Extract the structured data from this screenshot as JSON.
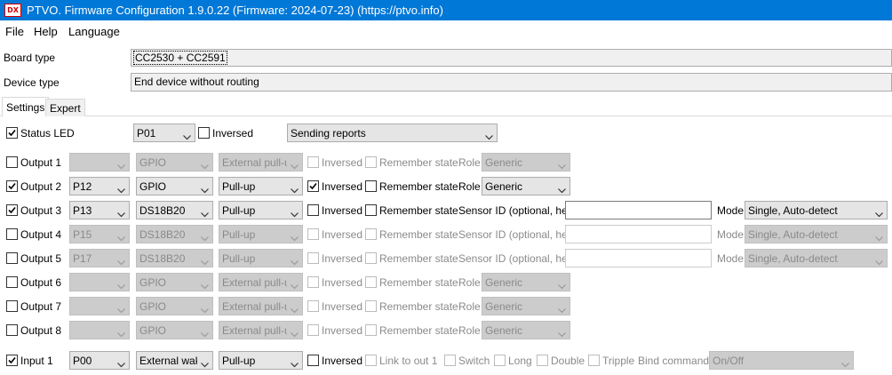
{
  "window": {
    "title": "PTVO. Firmware Configuration 1.9.0.22 (Firmware: 2024-07-23) (https://ptvo.info)",
    "icon_text": "DX"
  },
  "menu": [
    "File",
    "Help",
    "Language"
  ],
  "board": {
    "label": "Board type",
    "value": "CC2530 + CC2591"
  },
  "device": {
    "label": "Device type",
    "value": "End device without routing"
  },
  "tabs": [
    "Settings",
    "Expert"
  ],
  "common": {
    "inversed": "Inversed",
    "remember": "Remember state",
    "role": "Role",
    "sensor_id": "Sensor ID (optional, hex)",
    "mode": "Mode"
  },
  "status_led": {
    "label": "Status LED",
    "checked": true,
    "pin": "P01",
    "inversed_checked": false,
    "mode": "Sending reports"
  },
  "outputs": [
    {
      "label": "Output 1",
      "checked": false,
      "pin": "",
      "type": "GPIO",
      "pull": "External pull-up",
      "inversed": false,
      "remember": false,
      "kind": "role",
      "role": "Generic"
    },
    {
      "label": "Output 2",
      "checked": true,
      "pin": "P12",
      "type": "GPIO",
      "pull": "Pull-up",
      "inversed": true,
      "remember": false,
      "kind": "role",
      "role": "Generic"
    },
    {
      "label": "Output 3",
      "checked": true,
      "pin": "P13",
      "type": "DS18B20",
      "pull": "Pull-up",
      "inversed": false,
      "remember": false,
      "kind": "sensor",
      "sensor_id": "",
      "mode": "Single, Auto-detect"
    },
    {
      "label": "Output 4",
      "checked": false,
      "pin": "P15",
      "type": "DS18B20",
      "pull": "Pull-up",
      "inversed": false,
      "remember": false,
      "kind": "sensor",
      "sensor_id": "",
      "mode": "Single, Auto-detect"
    },
    {
      "label": "Output 5",
      "checked": false,
      "pin": "P17",
      "type": "DS18B20",
      "pull": "Pull-up",
      "inversed": false,
      "remember": false,
      "kind": "sensor",
      "sensor_id": "",
      "mode": "Single, Auto-detect"
    },
    {
      "label": "Output 6",
      "checked": false,
      "pin": "",
      "type": "GPIO",
      "pull": "External pull-up",
      "inversed": false,
      "remember": false,
      "kind": "role",
      "role": "Generic"
    },
    {
      "label": "Output 7",
      "checked": false,
      "pin": "",
      "type": "GPIO",
      "pull": "External pull-up",
      "inversed": false,
      "remember": false,
      "kind": "role",
      "role": "Generic"
    },
    {
      "label": "Output 8",
      "checked": false,
      "pin": "",
      "type": "GPIO",
      "pull": "External pull-up",
      "inversed": false,
      "remember": false,
      "kind": "role",
      "role": "Generic"
    }
  ],
  "input1": {
    "label": "Input 1",
    "checked": true,
    "pin": "P00",
    "type": "External wake",
    "pull": "Pull-up",
    "inversed": false,
    "link_label": "Link to out 1",
    "switch_label": "Switch",
    "long_label": "Long",
    "double_label": "Double",
    "triple_label": "Tripple",
    "bind_label": "Bind command",
    "bind_value": "On/Off"
  }
}
